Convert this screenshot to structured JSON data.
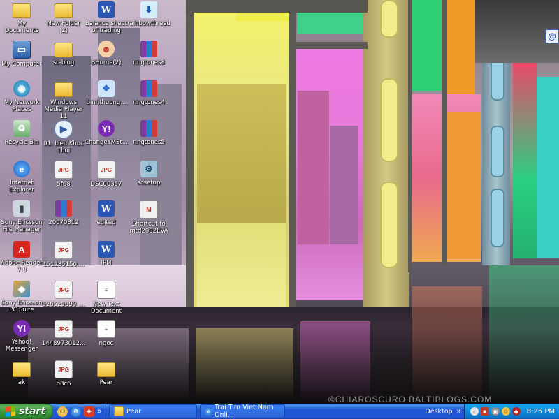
{
  "desktop": {
    "icons": [
      {
        "label": "My Documents",
        "glyph": "folder-icon"
      },
      {
        "label": "My Computer",
        "glyph": "computer-icon"
      },
      {
        "label": "My Network Places",
        "glyph": "network-icon"
      },
      {
        "label": "Recycle Bin",
        "glyph": "recycle-bin-icon"
      },
      {
        "label": "Internet Explorer",
        "glyph": "internet-explorer-icon"
      },
      {
        "label": "Sony Ericsson File Manager",
        "glyph": "phone-icon"
      },
      {
        "label": "Adobe Reader 7.0",
        "glyph": "pdf-icon"
      },
      {
        "label": "Sony Ericsson PC Suite",
        "glyph": "pc-suite-icon"
      },
      {
        "label": "Yahoo! Messenger",
        "glyph": "yahoo-messenger-icon"
      },
      {
        "label": "ak",
        "glyph": "folder-icon"
      },
      {
        "label": "New Folder (2)",
        "glyph": "folder-icon"
      },
      {
        "label": "sc-blog",
        "glyph": "folder-icon"
      },
      {
        "label": "Windows Media Player 11",
        "glyph": "folder-icon"
      },
      {
        "label": "01. Lien Khuc Thoi",
        "glyph": "media-file-icon"
      },
      {
        "label": "5f68",
        "glyph": "jpeg-icon"
      },
      {
        "label": "20070812",
        "glyph": "archive-icon"
      },
      {
        "label": "151235150....",
        "glyph": "jpeg-icon"
      },
      {
        "label": "626525690_...",
        "glyph": "jpeg-icon"
      },
      {
        "label": "1448973012...",
        "glyph": "jpeg-icon"
      },
      {
        "label": "b8c6",
        "glyph": "jpeg-icon"
      },
      {
        "label": "Balance sheet of trading",
        "glyph": "word-doc-icon"
      },
      {
        "label": "BHome(2)",
        "glyph": "bhome-icon"
      },
      {
        "label": "binhthuong...",
        "glyph": "document-icon"
      },
      {
        "label": "ChangeYMSt...",
        "glyph": "yahoo-messenger-icon"
      },
      {
        "label": "DSC00357",
        "glyph": "jpeg-icon"
      },
      {
        "label": "edited",
        "glyph": "word-doc-icon"
      },
      {
        "label": "IPM",
        "glyph": "word-doc-icon"
      },
      {
        "label": "New Text Document",
        "glyph": "text-file-icon"
      },
      {
        "label": "ngoc",
        "glyph": "text-file-icon"
      },
      {
        "label": "Pear",
        "glyph": "folder-icon"
      },
      {
        "label": "rainbowthread",
        "glyph": "installer-icon"
      },
      {
        "label": "ringtones3",
        "glyph": "archive-icon"
      },
      {
        "label": "ringtones4",
        "glyph": "archive-icon"
      },
      {
        "label": "ringtones5",
        "glyph": "archive-icon"
      },
      {
        "label": "scsetup",
        "glyph": "setup-icon"
      },
      {
        "label": "Shortcut to mtd2002EVA",
        "glyph": "shortcut-icon"
      }
    ],
    "corner_icon": "@",
    "watermark": "©CHIAROSCURO.BALTIBLOGS.COM"
  },
  "taskbar": {
    "start_label": "start",
    "quick_launch": [
      "msn-messenger-icon",
      "internet-explorer-icon",
      "show-desktop-icon"
    ],
    "more_symbol": "»",
    "tasks": [
      {
        "label": "Pear",
        "icon": "folder-icon"
      },
      {
        "label": "Trai Tim Viet Nam Onli...",
        "icon": "internet-explorer-icon"
      }
    ],
    "desktop_toolbar": "Desktop",
    "tray_icons": [
      "back-arrow-icon",
      "security-icon",
      "network-icon",
      "messenger-icon",
      "antivirus-icon"
    ],
    "clock": "8:25 PM"
  },
  "colors": {
    "taskbar_blue": "#2157d7",
    "start_green": "#3a9a3a",
    "tray_blue": "#0f8ad8"
  }
}
